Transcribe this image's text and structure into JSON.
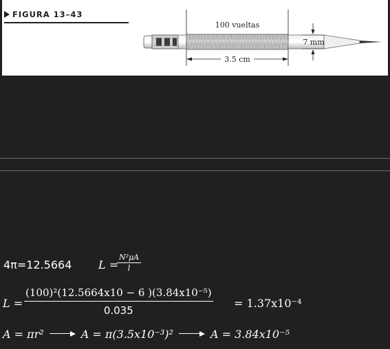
{
  "figure": {
    "label": "FIGURA 13–43",
    "turns_label": "100 vueltas",
    "length_label": "3.5 cm",
    "diameter_label": "7 mm"
  },
  "equations": {
    "line1": {
      "four_pi": "4π=12.5664",
      "L": "L =",
      "frac_num": "N²μA",
      "frac_den": "l"
    },
    "line2": {
      "L": "L =",
      "numerator": "(100)²(12.5664x10 − 6 )(3.84x10⁻⁵)",
      "denominator": "0.035",
      "result": "= 1.37x10⁻⁴"
    },
    "line3": {
      "area_formula": "A = πr²",
      "area_sub": "A = π(3.5x10⁻³)²",
      "area_result": "A = 3.84x10⁻⁵"
    }
  }
}
